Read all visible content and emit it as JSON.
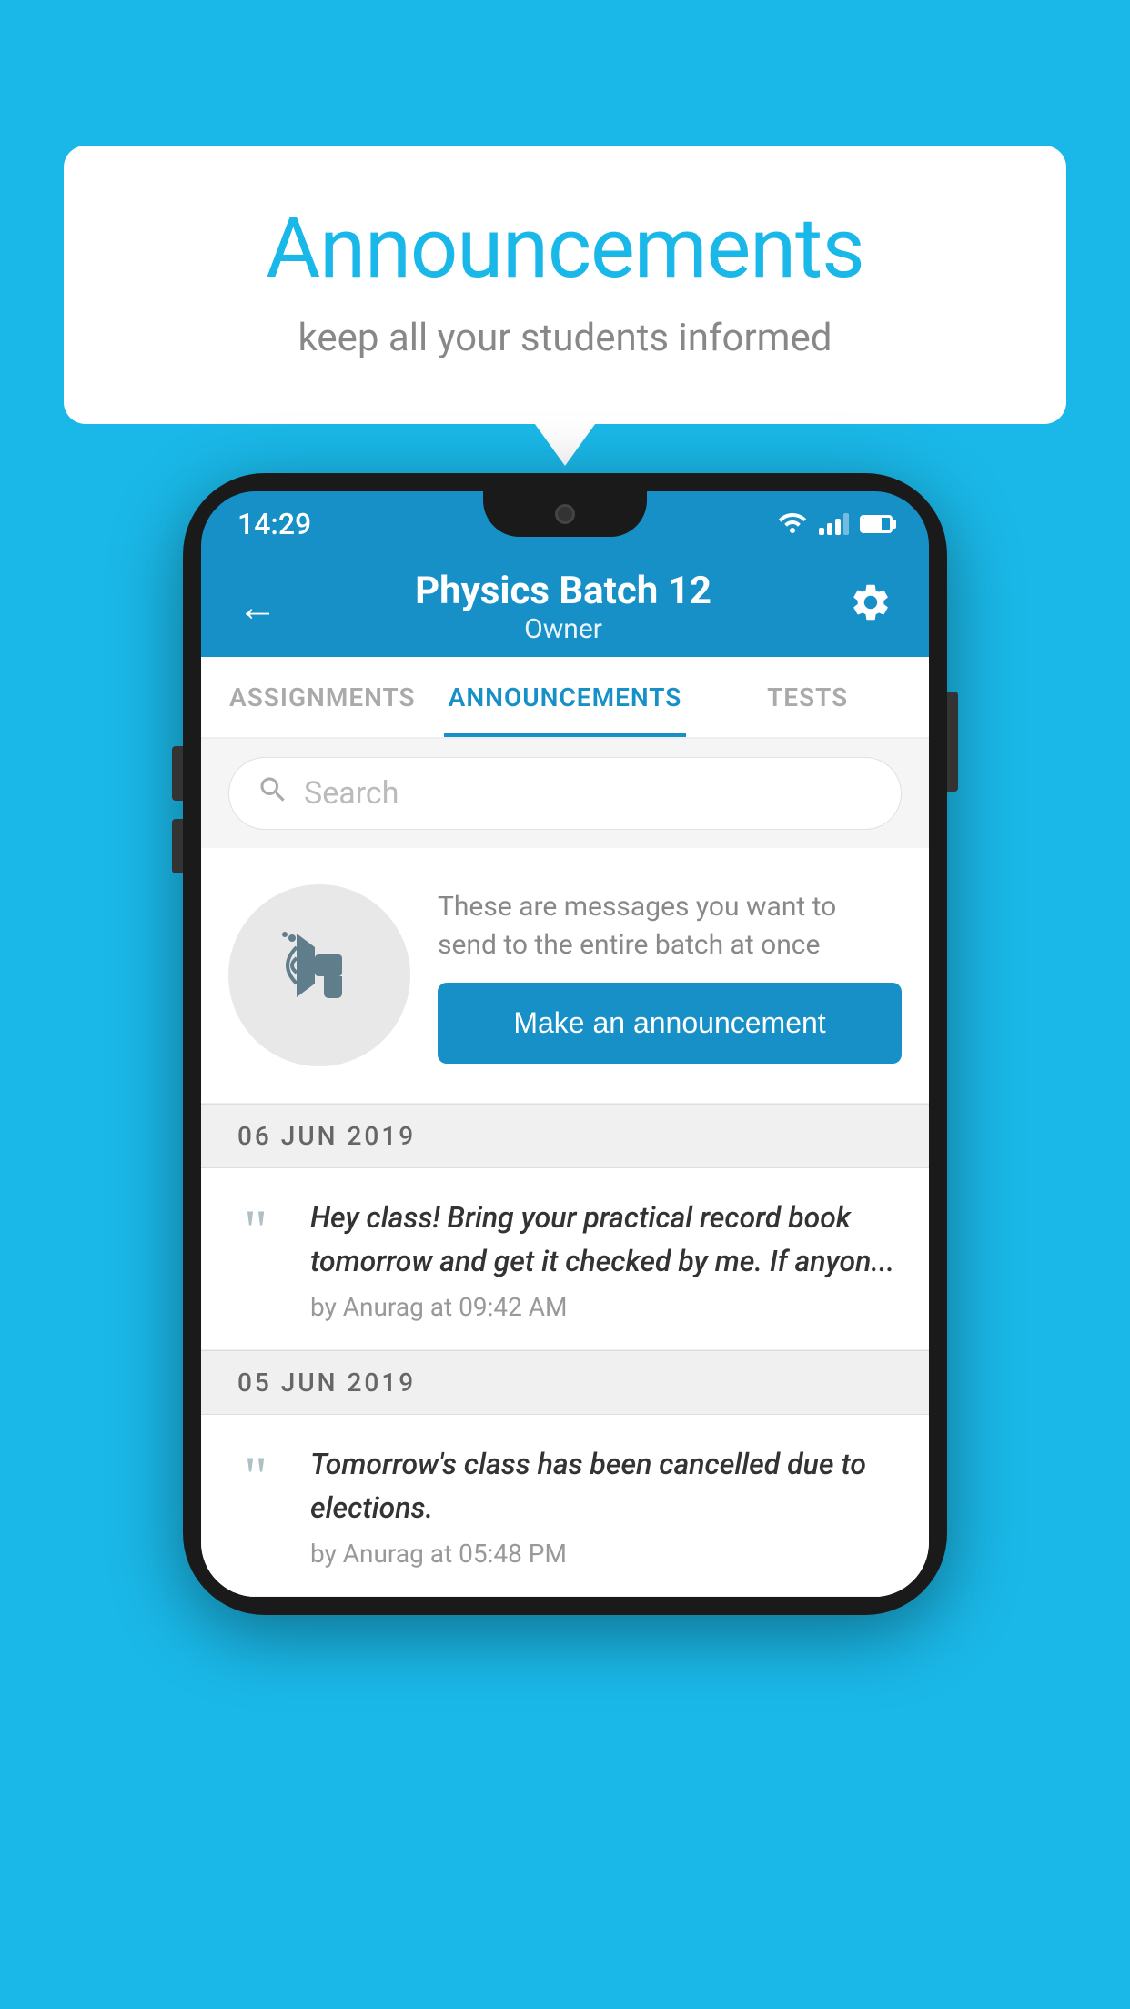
{
  "background_color": "#1ab8e8",
  "speech_bubble": {
    "title": "Announcements",
    "subtitle": "keep all your students informed"
  },
  "phone": {
    "status_bar": {
      "time": "14:29"
    },
    "header": {
      "title": "Physics Batch 12",
      "subtitle": "Owner",
      "back_icon": "←",
      "gear_icon": "⚙"
    },
    "tabs": [
      {
        "label": "ASSIGNMENTS",
        "active": false
      },
      {
        "label": "ANNOUNCEMENTS",
        "active": true
      },
      {
        "label": "TESTS",
        "active": false
      }
    ],
    "search": {
      "placeholder": "Search"
    },
    "cta_section": {
      "description": "These are messages you want to send to the entire batch at once",
      "button_label": "Make an announcement"
    },
    "announcements": [
      {
        "date": "06  JUN  2019",
        "text": "Hey class! Bring your practical record book tomorrow and get it checked by me. If anyon...",
        "meta": "by Anurag at 09:42 AM"
      },
      {
        "date": "05  JUN  2019",
        "text": "Tomorrow's class has been cancelled due to elections.",
        "meta": "by Anurag at 05:48 PM"
      }
    ]
  }
}
